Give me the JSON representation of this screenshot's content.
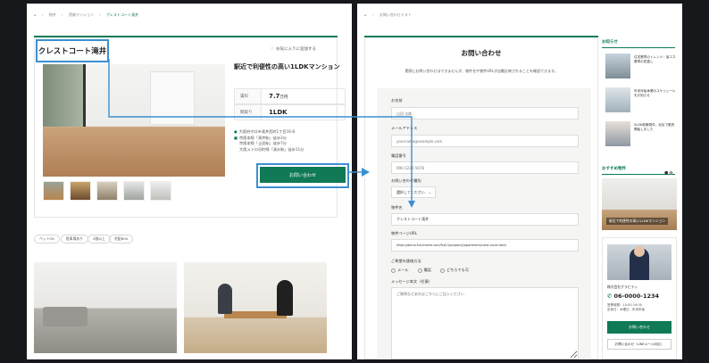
{
  "left": {
    "breadcrumb": [
      "⌂",
      "›",
      "物件",
      "›",
      "賃貸マンション",
      "›",
      "クレストコート滝井"
    ],
    "property_name": "クレストコート滝井",
    "favorite_label": "お気に入りに追加する",
    "heading": "駅近で利便性の高い1LDKマンション",
    "specs": [
      {
        "key": "賃料",
        "value": "7.7",
        "unit": "万円"
      },
      {
        "key": "間取り",
        "value": "1LDK",
        "unit": ""
      }
    ],
    "address": "大阪府守口市滝井西町1丁目16-8",
    "access": [
      "京阪本線「滝井駅」徒歩3分",
      "京阪本線「土居駅」徒歩7分",
      "大阪メトロ谷町線「清水駅」徒歩11分"
    ],
    "contact_button": "お問い合わせ",
    "tags": [
      "ペットOK",
      "駐車場あり",
      "2階以上",
      "宅配BOX"
    ]
  },
  "right": {
    "breadcrumb": [
      "⌂",
      "›",
      "お問い合わせテスト"
    ],
    "form_title": "お問い合わせ",
    "form_desc": "実際にお問い合わせはできませんが、物件名や物件URLが自動反映されることを確認できます。",
    "fields": {
      "name_label": "お名前",
      "name_placeholder": "山田 太郎",
      "email_label": "メールアドレス",
      "email_placeholder": "yourname@example.com",
      "phone_label": "電話番号",
      "phone_placeholder": "090-1234-5678",
      "type_label": "お問い合わせ種別",
      "type_value": "選択してください",
      "property_label": "物件名",
      "property_value": "クレストコート滝井",
      "url_label": "物件ページURL",
      "url_value": "https://demo.fcb-theme.com/fcb11/property/apartment/crest-court-takii/",
      "method_label": "ご希望の連絡方法",
      "methods": [
        "メール",
        "電話",
        "どちらでも可"
      ],
      "message_label": "メッセージ本文（任意）",
      "message_placeholder": "ご質問などあればこちらにご記入ください"
    },
    "sidebar": {
      "news_heading": "お知らせ",
      "news": [
        "住宅業界のトレンド：省エネ基準の見直し",
        "年末年始休業のスケジュールをお知らせ",
        "5LDK新築物件、北区で販売開始しました"
      ],
      "recommend_heading": "おすすめ物件",
      "recommend_caption": "駅近で利便性の高い1LDKマンション",
      "company": "株式会社グラビティ",
      "phone": "06-0000-1234",
      "hours": [
        "営業時間：10:00-19:00",
        "定休日：水曜日、年末年始"
      ],
      "contact_button": "お問い合わせ",
      "line_button": "お問い合わせ（LINEメール対応）"
    }
  },
  "colors": {
    "accent": "#0f7a55",
    "highlight": "#3b8fd1",
    "background": "#16181b"
  }
}
